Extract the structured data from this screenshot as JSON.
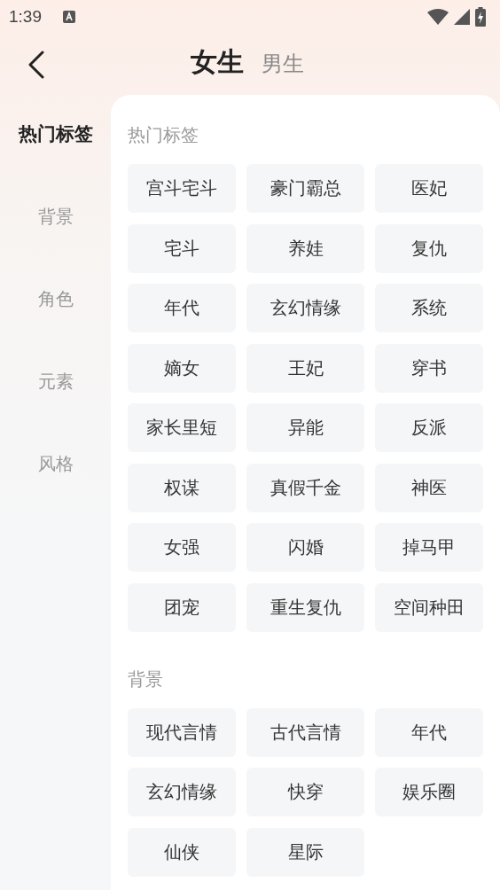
{
  "status_bar": {
    "time": "1:39"
  },
  "header": {
    "tabs": [
      {
        "label": "女生",
        "selected": true
      },
      {
        "label": "男生",
        "selected": false
      }
    ]
  },
  "sidebar": {
    "items": [
      {
        "label": "热门标签",
        "selected": true
      },
      {
        "label": "背景",
        "selected": false
      },
      {
        "label": "角色",
        "selected": false
      },
      {
        "label": "元素",
        "selected": false
      },
      {
        "label": "风格",
        "selected": false
      }
    ]
  },
  "sections": [
    {
      "title": "热门标签",
      "tags": [
        "宫斗宅斗",
        "豪门霸总",
        "医妃",
        "宅斗",
        "养娃",
        "复仇",
        "年代",
        "玄幻情缘",
        "系统",
        "嫡女",
        "王妃",
        "穿书",
        "家长里短",
        "异能",
        "反派",
        "权谋",
        "真假千金",
        "神医",
        "女强",
        "闪婚",
        "掉马甲",
        "团宠",
        "重生复仇",
        "空间种田"
      ]
    },
    {
      "title": "背景",
      "tags": [
        "现代言情",
        "古代言情",
        "年代",
        "玄幻情缘",
        "快穿",
        "娱乐圈",
        "仙侠",
        "星际"
      ]
    }
  ]
}
